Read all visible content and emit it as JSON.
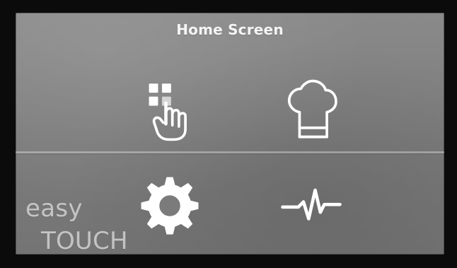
{
  "screen": {
    "title": "Home Screen"
  },
  "buttons": [
    {
      "id": "tiles",
      "icon": "tiles-hand-icon"
    },
    {
      "id": "recipes",
      "icon": "chef-hat-icon"
    },
    {
      "id": "settings",
      "icon": "gear-icon"
    },
    {
      "id": "activity",
      "icon": "activity-icon"
    }
  ],
  "brand": {
    "line1": "easy",
    "line2": "TOUCH"
  },
  "colors": {
    "screen_bg": "#7b7b7b",
    "icon": "#ffffff",
    "brand_text": "#e6e6e6"
  }
}
